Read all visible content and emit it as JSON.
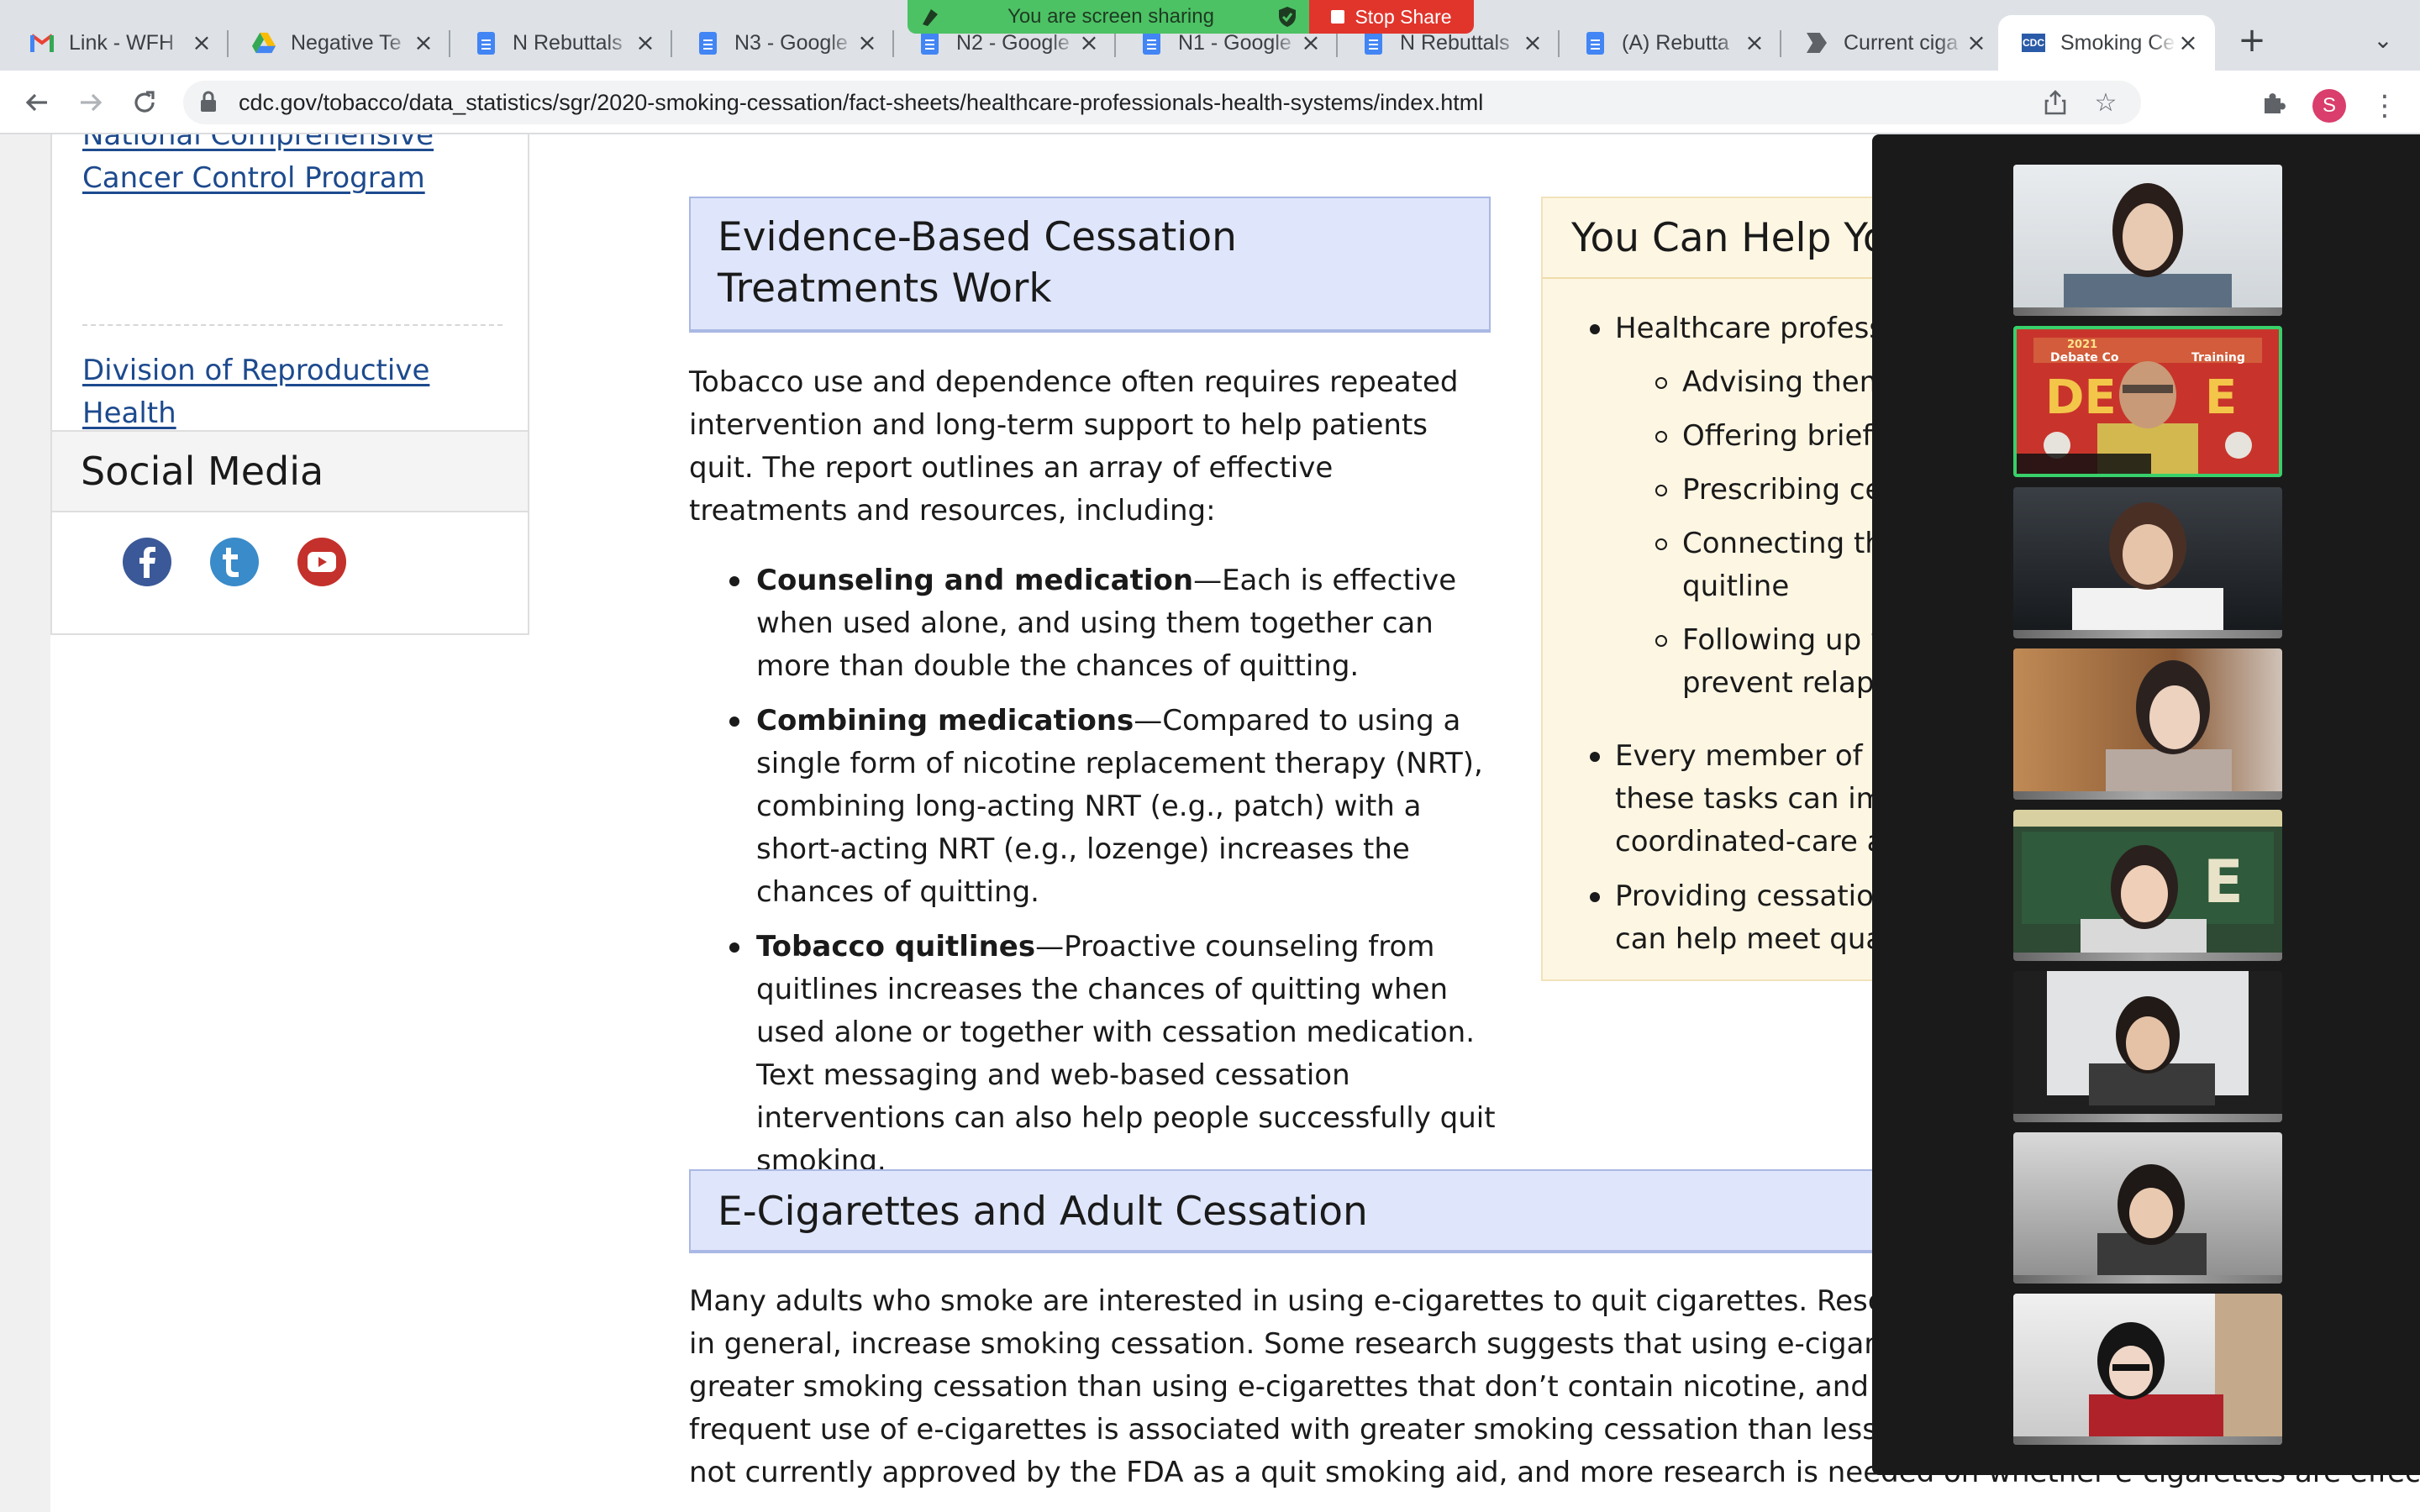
{
  "browser": {
    "tabs": [
      {
        "title": "Link - WFH",
        "icon": "gmail-icon"
      },
      {
        "title": "Negative Te",
        "icon": "google-drive-icon"
      },
      {
        "title": "N Rebuttals",
        "icon": "google-docs-icon"
      },
      {
        "title": "N3 - Google",
        "icon": "google-docs-icon"
      },
      {
        "title": "N2 - Google",
        "icon": "google-docs-icon"
      },
      {
        "title": "N1 - Google",
        "icon": "google-docs-icon"
      },
      {
        "title": "N Rebuttals",
        "icon": "google-docs-icon"
      },
      {
        "title": "(A) Rebutta",
        "icon": "google-docs-icon"
      },
      {
        "title": "Current ciga",
        "icon": "arrow-doc-icon"
      },
      {
        "title": "Smoking Ce",
        "icon": "cdc-icon",
        "active": true
      }
    ],
    "url_host": "cdc.gov",
    "url_path": "/tobacco/data_statistics/sgr/2020-smoking-cessation/fact-sheets/healthcare-professionals-health-systems/index.html",
    "profile_initial": "S"
  },
  "screen_share": {
    "status": "You are screen sharing",
    "stop_label": "Stop Share"
  },
  "sidebar": {
    "links": [
      "National Comprehensive Cancer Control Program",
      "Division of Reproductive Health"
    ],
    "social_title": "Social Media",
    "social_icons": [
      "facebook-icon",
      "twitter-icon",
      "youtube-icon"
    ]
  },
  "main": {
    "evidence": {
      "heading": "Evidence-Based Cessation Treatments Work",
      "intro": "Tobacco use and dependence often requires repeated intervention and long-term support to help patients quit. The report outlines an array of effective treatments and resources, including:",
      "items": [
        {
          "bold": "Counseling and medication",
          "text": "—Each is effective when used alone, and using them together can more than double the chances of quitting."
        },
        {
          "bold": "Combining medications",
          "text": "—Compared to using a single form of nicotine replacement therapy (NRT), combining long-acting NRT (e.g., patch) with a short-acting NRT (e.g., lozenge) increases the chances of quitting."
        },
        {
          "bold": "Tobacco quitlines",
          "text": "—Proactive counseling from quitlines increases the chances of quitting when used alone or together with cessation medication. Text messaging and web-based cessation interventions can also help people successfully quit smoking."
        }
      ]
    },
    "ecig": {
      "heading": "E-Cigarettes and Adult Cessation",
      "lines": [
        "Many adults who smoke are interested in using e-cigarettes to quit cigarettes. Research is",
        "in general, increase smoking cessation. Some research suggests that using e-cigarettes co",
        "greater smoking cessation than using e-cigarettes that don’t contain nicotine, and some r",
        "frequent use of e-cigarettes is associated with greater smoking cessation than less freque",
        "not currently approved by the FDA as a quit smoking aid, and more research is needed on whether e-cigarettes are effective"
      ]
    }
  },
  "aside": {
    "heading": "You Can Help Yo",
    "b1": "Healthcare professi",
    "subs": [
      "Advising them",
      "Offering brief c",
      "Prescribing ces",
      "Connecting the",
      "quitline",
      "Following up w",
      "prevent relaps"
    ],
    "b2": [
      "Every member of th",
      "these tasks can imp",
      "coordinated-care ap"
    ],
    "b3": [
      "Providing cessation",
      "can help meet quali"
    ]
  },
  "video_gallery": {
    "tile_banner_year": "2021",
    "tile_banner_text": "Debate Co",
    "tile_banner_text2": "Training",
    "tile_banner_big": "DE",
    "tile_banner_big2": "E"
  }
}
